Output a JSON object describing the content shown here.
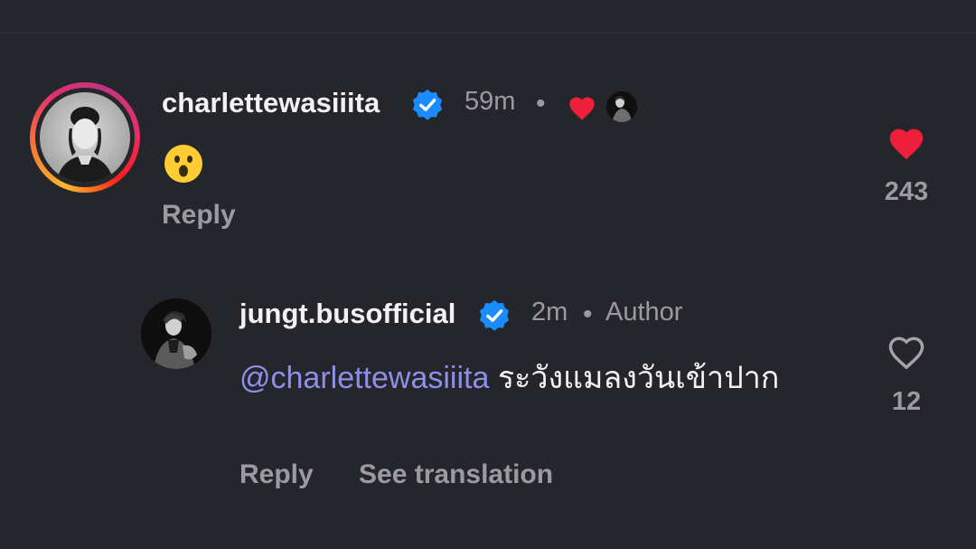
{
  "comments": [
    {
      "username": "charlettewasiiita",
      "time": "59m",
      "separator": "•",
      "body_emoji": "😮",
      "reply_label": "Reply",
      "like_count": "243",
      "liked": true
    },
    {
      "username": "jungt.busofficial",
      "time": "2m",
      "separator": "•",
      "author_label": "Author",
      "mention": "@charlettewasiiita",
      "body_text": " ระวังแมลงวันเข้าปาก",
      "reply_label": "Reply",
      "translate_label": "See translation",
      "like_count": "12",
      "liked": false
    }
  ],
  "colors": {
    "background": "#25262b",
    "muted_text": "#9a9ba1",
    "mention": "#8e8fe8",
    "like_red": "#ed1f3a",
    "verified_blue": "#1a8cff"
  },
  "icons": {
    "verified": "verified-badge-icon",
    "heart_filled": "heart-filled-icon",
    "heart_outline": "heart-outline-icon"
  }
}
